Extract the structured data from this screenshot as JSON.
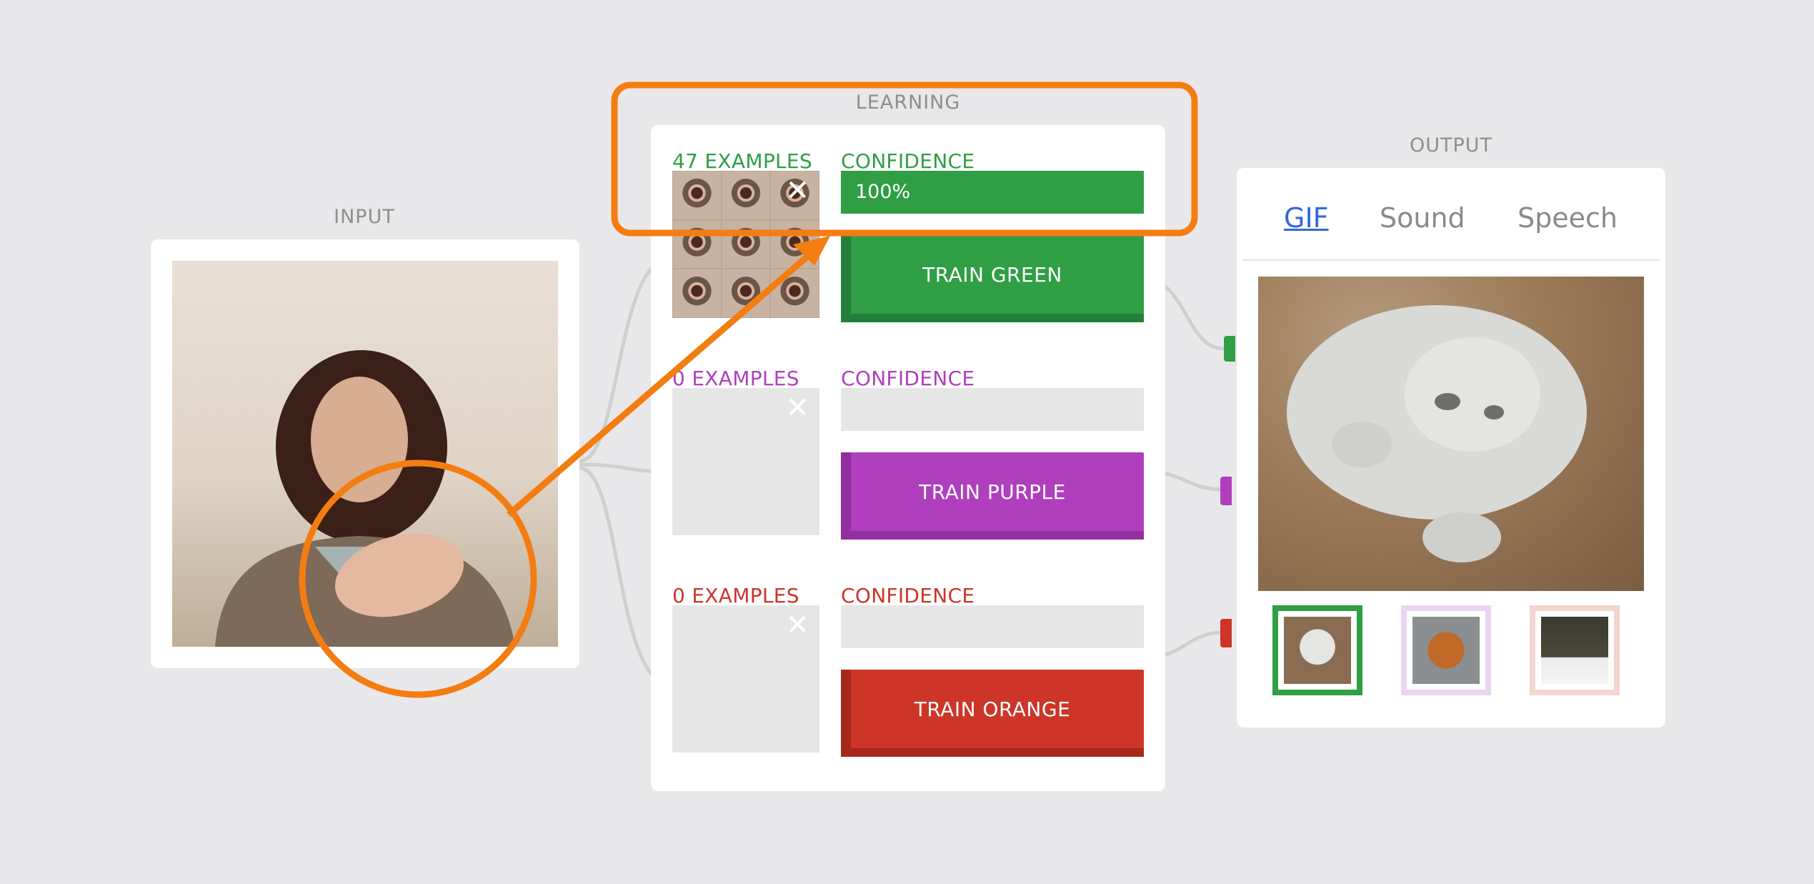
{
  "input": {
    "label": "INPUT"
  },
  "learning": {
    "label": "LEARNING",
    "classes": [
      {
        "examples_label": "47 EXAMPLES",
        "confidence_label": "CONFIDENCE",
        "confidence_text": "100%",
        "confidence": 1.0,
        "train_label": "TRAIN GREEN",
        "color": "#2f9e44",
        "dark": "#23803a",
        "has_examples": true
      },
      {
        "examples_label": "0 EXAMPLES",
        "confidence_label": "CONFIDENCE",
        "confidence_text": "",
        "confidence": 0.0,
        "train_label": "TRAIN PURPLE",
        "color": "#b03fbe",
        "dark": "#922e9e",
        "has_examples": false
      },
      {
        "examples_label": "0 EXAMPLES",
        "confidence_label": "CONFIDENCE",
        "confidence_text": "",
        "confidence": 0.0,
        "train_label": "TRAIN ORANGE",
        "color": "#cc3527",
        "dark": "#a8271c",
        "has_examples": false
      }
    ],
    "close_symbol": "✕"
  },
  "output": {
    "label": "OUTPUT",
    "tabs": {
      "gif": "GIF",
      "sound": "Sound",
      "speech": "Speech"
    },
    "selected_tab": "GIF",
    "thumbnails": [
      {
        "name": "white-cat",
        "border_color": "#2f9e44"
      },
      {
        "name": "orange-cat",
        "border_color": "#ead5ef"
      },
      {
        "name": "dark-cat",
        "border_color": "#f3d4cf"
      }
    ]
  },
  "annotation": {
    "color": "#f47d12"
  }
}
